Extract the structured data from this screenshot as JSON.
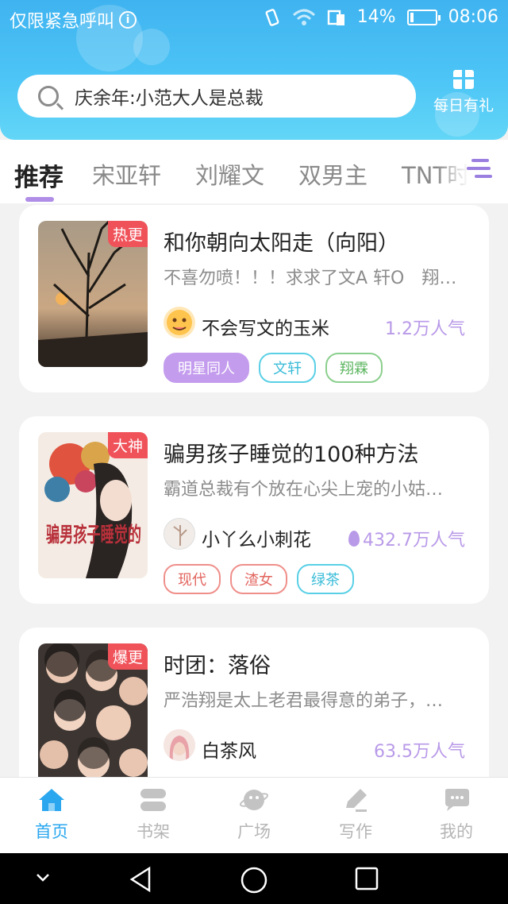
{
  "status": {
    "left_text": "仅限紧急呼叫",
    "battery": "14%",
    "time": "08:06",
    "battery_level": 0.14
  },
  "search": {
    "text": "庆余年:小范大人是总裁"
  },
  "gift": {
    "label": "每日有礼"
  },
  "tabs": [
    "推荐",
    "宋亚轩",
    "刘耀文",
    "双男主",
    "TNT时代少年团"
  ],
  "cards": [
    {
      "badge": "热更",
      "title": "和你朝向太阳走（向阳）",
      "desc": "不喜勿喷！！！求求了文A 轩O　翔…",
      "author": "不会写文的玉米",
      "popularity": "1.2万人气",
      "tags": [
        "明星同人",
        "文轩",
        "翔霖"
      ]
    },
    {
      "badge": "大神",
      "title": "骗男孩子睡觉的100种方法",
      "desc": "霸道总裁有个放在心尖上宠的小姑…",
      "author": "小丫么小刺花",
      "popularity": "432.7万人气",
      "tags": [
        "现代",
        "渣女",
        "绿茶"
      ],
      "cover_text": "骗男孩子睡觉的"
    },
    {
      "badge": "爆更",
      "title": "时团：落俗",
      "desc": "严浩翔是太上老君最得意的弟子，…",
      "author": "白茶风",
      "popularity": "63.5万人气",
      "tags": []
    }
  ],
  "nav": [
    "首页",
    "书架",
    "广场",
    "写作",
    "我的"
  ],
  "colors": {
    "accent": "#2aa7ee",
    "purple": "#b08ee8",
    "badge": "#f0525a"
  }
}
